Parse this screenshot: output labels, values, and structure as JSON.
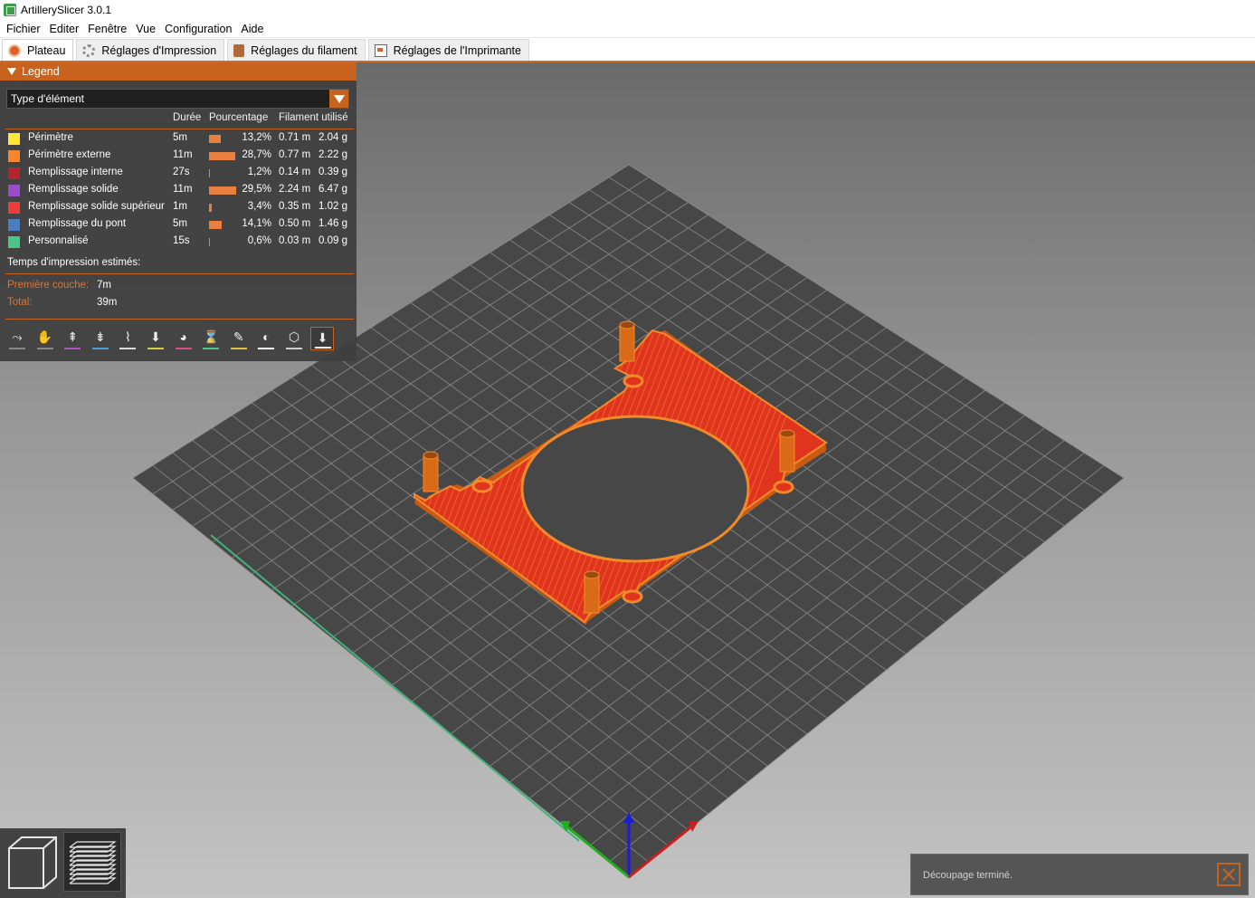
{
  "window": {
    "title": "ArtillerySlicer 3.0.1"
  },
  "menu": [
    "Fichier",
    "Editer",
    "Fenêtre",
    "Vue",
    "Configuration",
    "Aide"
  ],
  "tabs": [
    {
      "label": "Plateau",
      "icon": "plate-icon",
      "active": true
    },
    {
      "label": "Réglages d'Impression",
      "icon": "gear-icon",
      "active": false
    },
    {
      "label": "Réglages du filament",
      "icon": "spool-icon",
      "active": false
    },
    {
      "label": "Réglages de l'Imprimante",
      "icon": "printer-icon",
      "active": false
    }
  ],
  "legend": {
    "header": "Legend",
    "view_type": "Type d'élément",
    "columns": {
      "duration": "Durée",
      "percentage": "Pourcentage",
      "filament": "Filament utilisé"
    },
    "rows": [
      {
        "label": "Périmètre",
        "color": "#ffe73a",
        "duration": "5m",
        "bar": 0.44,
        "percent": "13,2%",
        "meters": "0.71 m",
        "grams": "2.04 g"
      },
      {
        "label": "Périmètre externe",
        "color": "#f68530",
        "duration": "11m",
        "bar": 0.96,
        "percent": "28,7%",
        "meters": "0.77 m",
        "grams": "2.22 g"
      },
      {
        "label": "Remplissage interne",
        "color": "#b3242c",
        "duration": "27s",
        "bar": 0.04,
        "percent": "1,2%",
        "meters": "0.14 m",
        "grams": "0.39 g"
      },
      {
        "label": "Remplissage solide",
        "color": "#9b4cc8",
        "duration": "11m",
        "bar": 1.0,
        "percent": "29,5%",
        "meters": "2.24 m",
        "grams": "6.47 g"
      },
      {
        "label": "Remplissage solide supérieur",
        "color": "#ef3b3b",
        "duration": "1m",
        "bar": 0.11,
        "percent": "3,4%",
        "meters": "0.35 m",
        "grams": "1.02 g"
      },
      {
        "label": "Remplissage du pont",
        "color": "#4a7dc4",
        "duration": "5m",
        "bar": 0.47,
        "percent": "14,1%",
        "meters": "0.50 m",
        "grams": "1.46 g"
      },
      {
        "label": "Personnalisé",
        "color": "#4ac68a",
        "duration": "15s",
        "bar": 0.02,
        "percent": "0,6%",
        "meters": "0.03 m",
        "grams": "0.09 g"
      }
    ],
    "estimated_title": "Temps d'impression estimés:",
    "first_layer_label": "Première couche:",
    "first_layer_value": "7m",
    "total_label": "Total:",
    "total_value": "39m"
  },
  "toolbar": [
    {
      "name": "travel-icon",
      "glyph": "⤳",
      "color": "#888888"
    },
    {
      "name": "wipe-icon",
      "glyph": "✋",
      "color": "#888888"
    },
    {
      "name": "retractions-icon",
      "glyph": "⇞",
      "color": "#b050c8"
    },
    {
      "name": "deretractions-icon",
      "glyph": "⇟",
      "color": "#4aa0d8"
    },
    {
      "name": "seams-icon",
      "glyph": "⌇",
      "color": "#dddddd"
    },
    {
      "name": "tool-changes-icon",
      "glyph": "⬇",
      "color": "#d0d040"
    },
    {
      "name": "color-changes-icon",
      "glyph": "◕",
      "color": "#e04a8a"
    },
    {
      "name": "pause-prints-icon",
      "glyph": "⌛",
      "color": "#4ac68a"
    },
    {
      "name": "custom-gcodes-icon",
      "glyph": "✎",
      "color": "#e0c040"
    },
    {
      "name": "center-of-gravity-icon",
      "glyph": "◐",
      "color": "#ffffff"
    },
    {
      "name": "shells-icon",
      "glyph": "⬡",
      "color": "#cccccc"
    },
    {
      "name": "tool-marker-icon",
      "glyph": "⬇",
      "color": "#ffffff",
      "active": true
    }
  ],
  "view_buttons": [
    "3d-view-icon",
    "preview-layers-icon"
  ],
  "notification": {
    "text": "Découpage terminé."
  }
}
